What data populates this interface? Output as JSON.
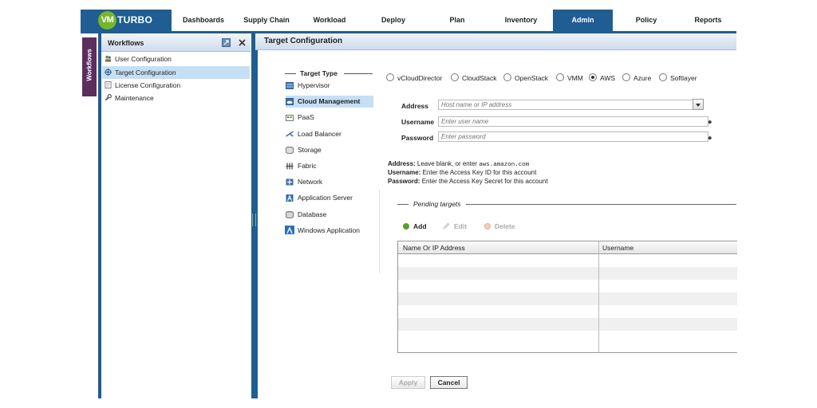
{
  "app": {
    "logo_vm": "VM",
    "logo_text": "TURBO",
    "brand_color": "#1f5d92",
    "accent_color": "#76b72a"
  },
  "nav": {
    "items": [
      {
        "label": "Dashboards"
      },
      {
        "label": "Supply Chain"
      },
      {
        "label": "Workload"
      },
      {
        "label": "Deploy"
      },
      {
        "label": "Plan"
      },
      {
        "label": "Inventory"
      },
      {
        "label": "Admin",
        "active": true
      },
      {
        "label": "Policy"
      },
      {
        "label": "Reports"
      }
    ]
  },
  "sidebar": {
    "tab_label": "Workflows",
    "title": "Workflows",
    "items": [
      {
        "label": "User Configuration",
        "icon": "users-icon"
      },
      {
        "label": "Target Configuration",
        "icon": "target-icon",
        "selected": true
      },
      {
        "label": "License Configuration",
        "icon": "license-icon"
      },
      {
        "label": "Maintenance",
        "icon": "wrench-icon"
      }
    ]
  },
  "main": {
    "title": "Target Configuration",
    "target_type_label": "Target Type",
    "target_types": [
      {
        "label": "Hypervisor",
        "icon": "hypervisor-icon"
      },
      {
        "label": "Cloud Management",
        "icon": "cloud-icon",
        "selected": true
      },
      {
        "label": "PaaS",
        "icon": "paas-icon"
      },
      {
        "label": "Load Balancer",
        "icon": "load-balancer-icon"
      },
      {
        "label": "Storage",
        "icon": "storage-icon"
      },
      {
        "label": "Fabric",
        "icon": "fabric-icon"
      },
      {
        "label": "Network",
        "icon": "network-icon"
      },
      {
        "label": "Application Server",
        "icon": "app-server-icon"
      },
      {
        "label": "Database",
        "icon": "database-icon"
      },
      {
        "label": "Windows Application",
        "icon": "windows-app-icon"
      }
    ],
    "providers": [
      {
        "label": "vCloudDirector",
        "checked": false
      },
      {
        "label": "CloudStack",
        "checked": false
      },
      {
        "label": "OpenStack",
        "checked": false
      },
      {
        "label": "VMM",
        "checked": false
      },
      {
        "label": "AWS",
        "checked": true
      },
      {
        "label": "Azure",
        "checked": false
      },
      {
        "label": "Softlayer",
        "checked": false
      }
    ],
    "form": {
      "address_label": "Address",
      "address_placeholder": "Host name or IP address",
      "username_label": "Username",
      "username_placeholder": "Enter user name",
      "password_label": "Password",
      "password_placeholder": "Enter password",
      "required_mark": "◆"
    },
    "help": {
      "address_key": "Address:",
      "address_text": " Leave blank, or enter ",
      "address_example": "aws.amazon.com",
      "username_key": "Username:",
      "username_text": " Enter the Access Key ID for this account",
      "password_key": "Password:",
      "password_text": " Enter the Access Key Secret for this account"
    },
    "pending": {
      "label": "Pending targets",
      "add_label": "Add",
      "edit_label": "Edit",
      "delete_label": "Delete",
      "columns": [
        "Name Or IP Address",
        "Username"
      ]
    },
    "buttons": {
      "apply_label": "Apply",
      "cancel_label": "Cancel"
    }
  }
}
